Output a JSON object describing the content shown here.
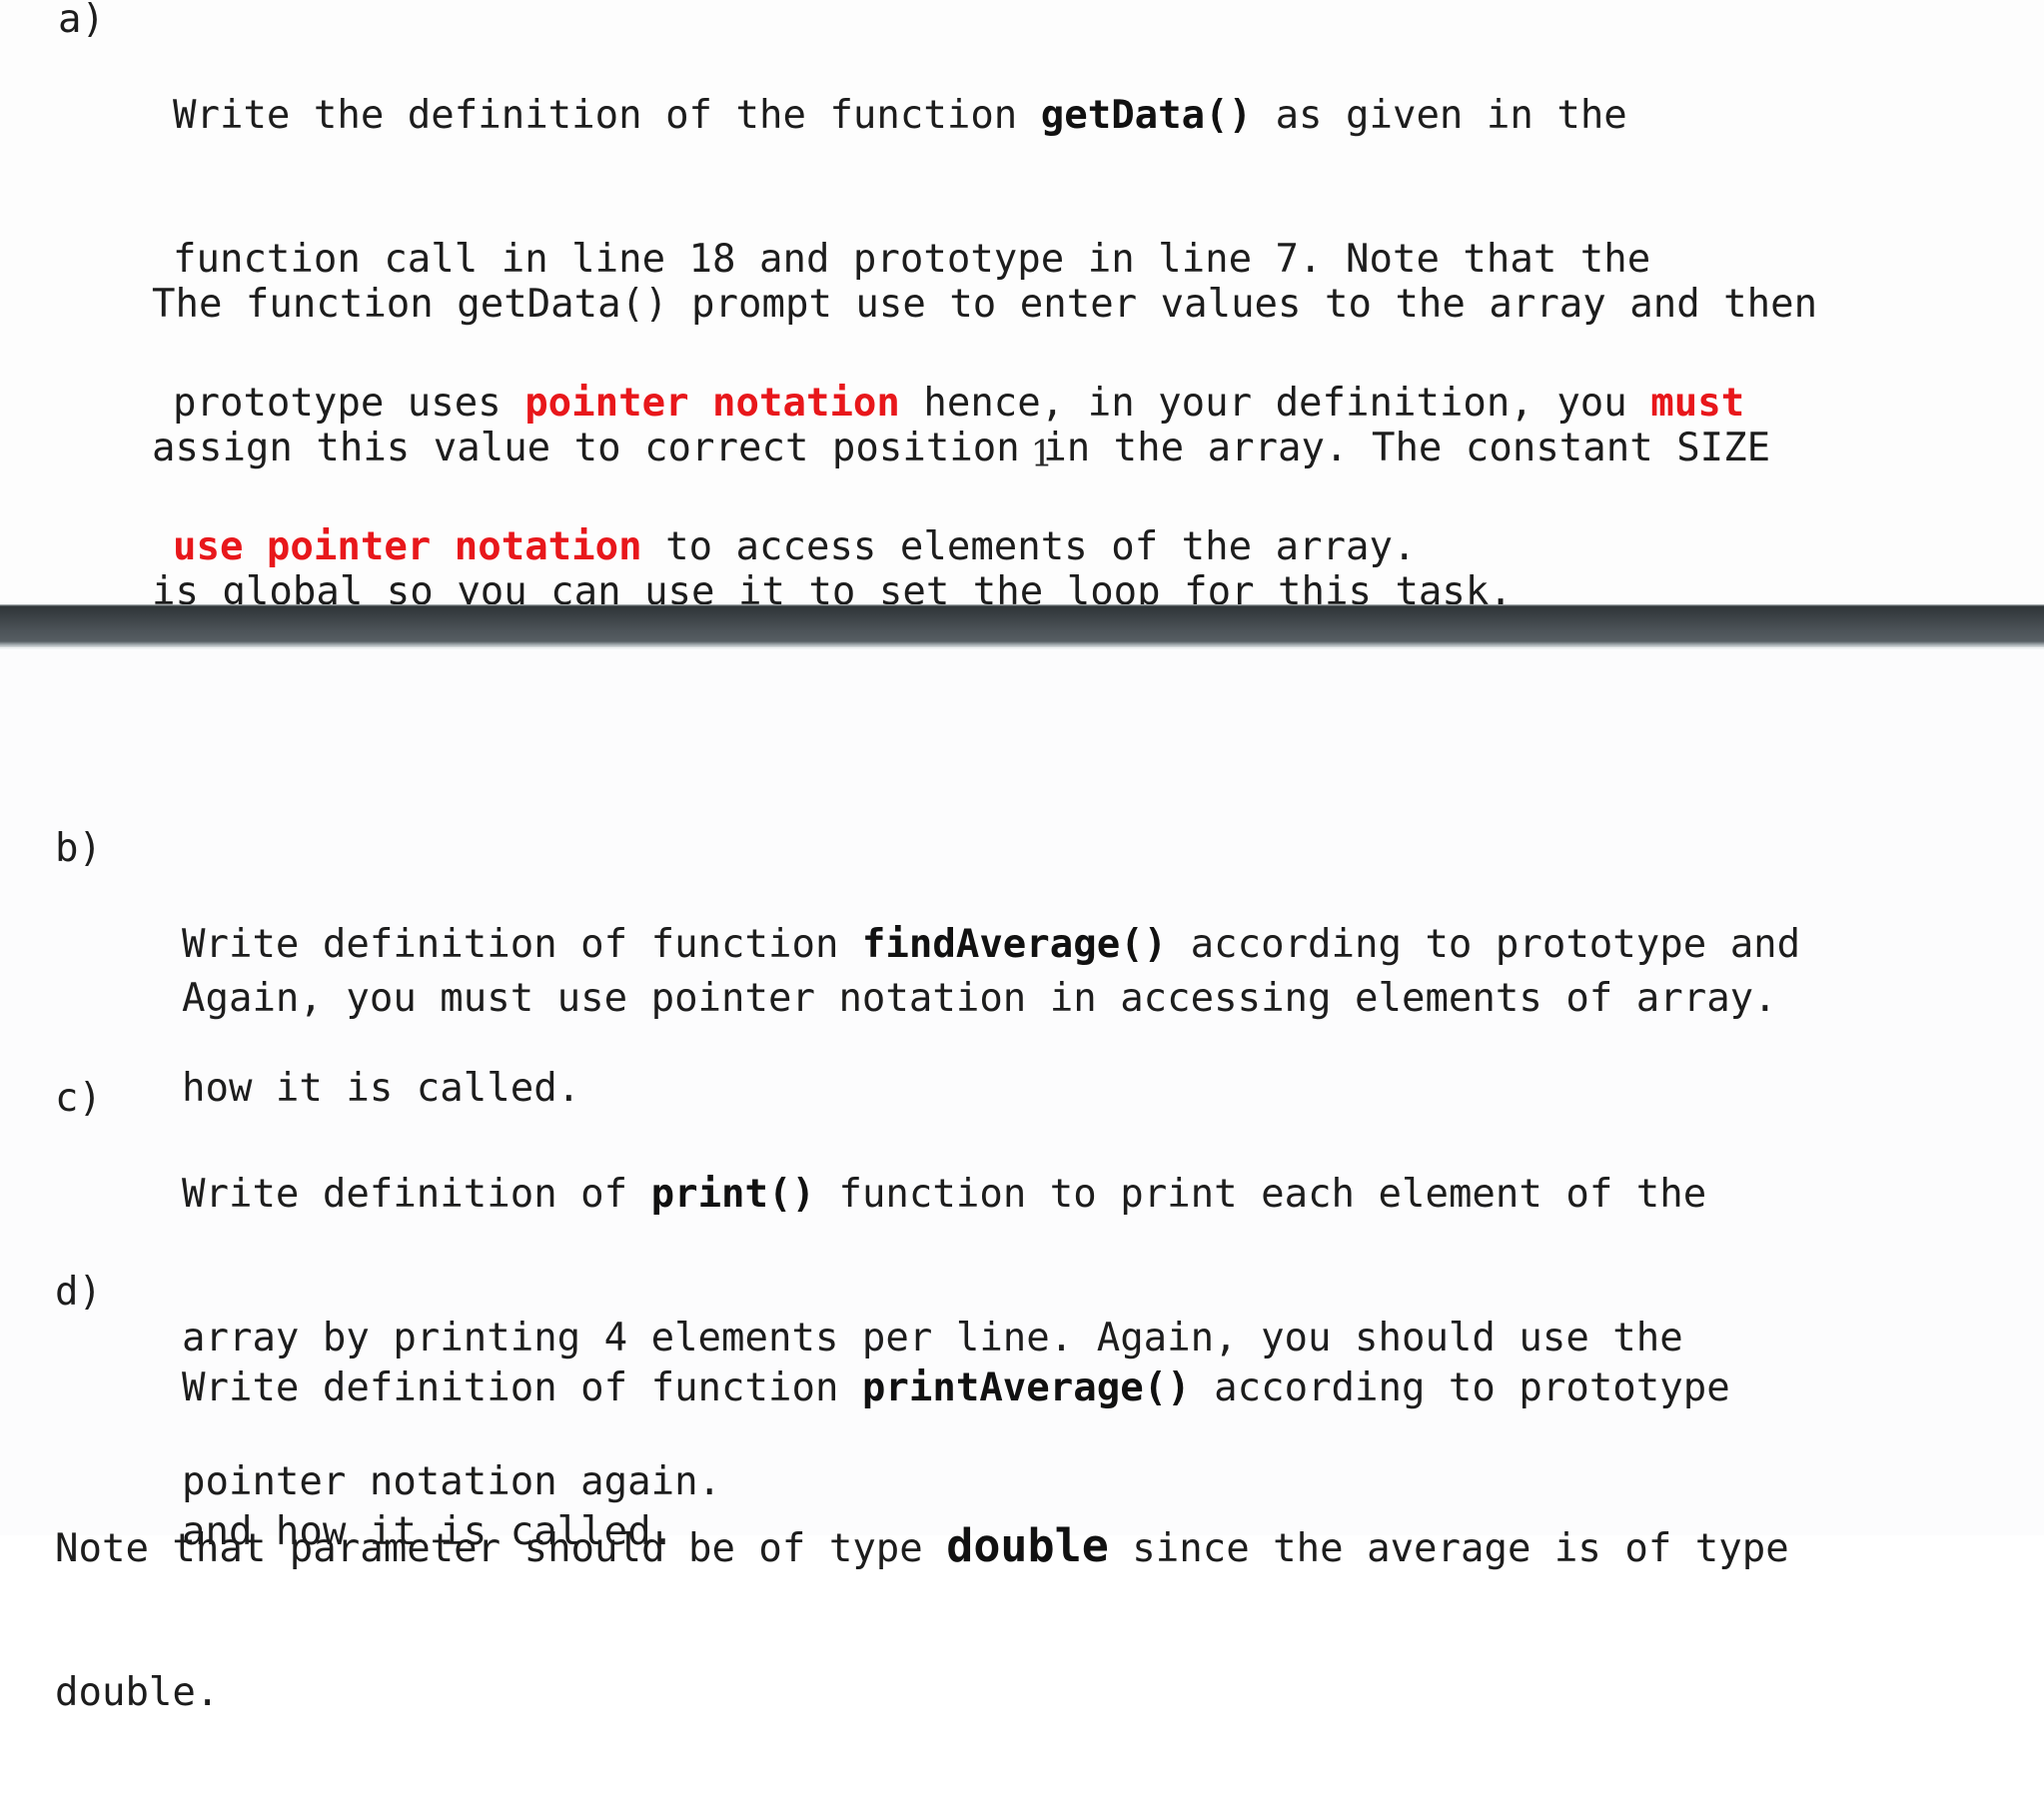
{
  "document": {
    "page_number": "1",
    "colors": {
      "text": "#1d1d1d",
      "emphasis_red": "#e8171b",
      "page_background": "#fdfdfd",
      "separator_band": "#3a4044"
    }
  },
  "items": {
    "a": {
      "marker": "a)",
      "paragraph1": {
        "line1_pre": "Write the definition of the function ",
        "line1_bold": "getData()",
        "line1_post": " as given in the",
        "line2": "function call in line 18 and prototype in line 7. Note that the",
        "line3_pre": "prototype uses ",
        "line3_red": "pointer notation",
        "line3_mid": " hence, in your definition, you ",
        "line3_red2": "must",
        "line4_red": "use pointer notation",
        "line4_post": " to access elements of the array."
      },
      "paragraph2": {
        "line1": "The function getData() prompt use to enter values to the array and then",
        "line2": "assign this value to correct position in the array. The constant SIZE",
        "line3": "is global so you can use it to set the loop for this task."
      }
    },
    "b": {
      "marker": "b)",
      "line1_pre": "Write definition of function ",
      "line1_bold": "findAverage()",
      "line1_post": " according to prototype and",
      "line2": "how it is called.",
      "note": "Again, you must use pointer notation in accessing elements of array."
    },
    "c": {
      "marker": "c)",
      "line1_pre": "Write definition of ",
      "line1_bold": "print()",
      "line1_post": " function to print each element of the",
      "line2": "array by printing 4 elements per line. Again, you should use the",
      "line3": "pointer notation again."
    },
    "d": {
      "marker": "d)",
      "line1_pre": "Write definition of function ",
      "line1_bold": "printAverage()",
      "line1_post": " according to prototype",
      "line2": "and how it is called."
    }
  },
  "footer_note": {
    "line1_pre": "Note that parameter should be of type ",
    "line1_bold": "double",
    "line1_post": " since the average is of type",
    "line2": "double."
  }
}
